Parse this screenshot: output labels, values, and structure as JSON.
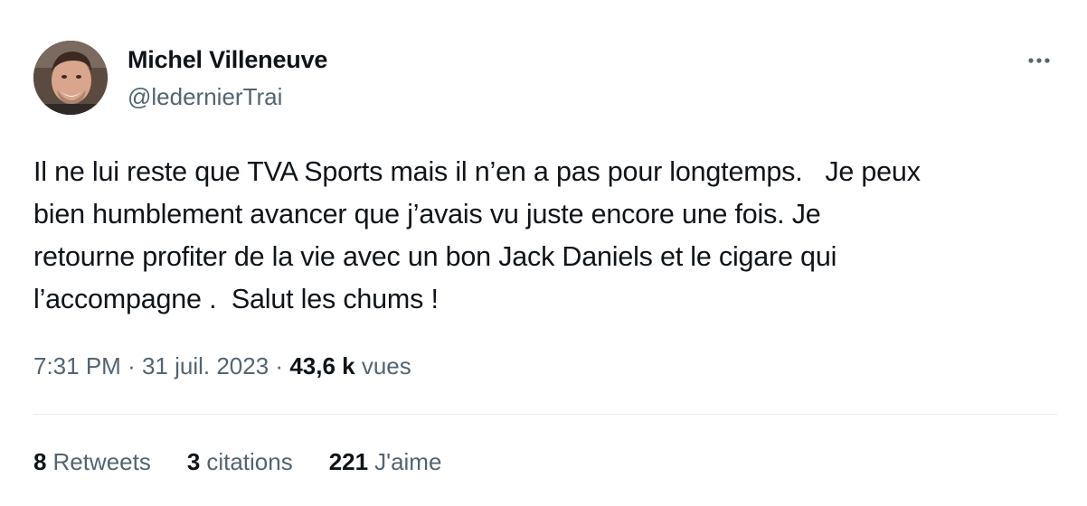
{
  "author": {
    "name": "Michel Villeneuve",
    "handle": "@ledernierTrai"
  },
  "tweet": {
    "lines": [
      "Il ne lui reste que TVA Sports mais il n’en a pas pour longtemps.   Je peux",
      "bien humblement avancer que j’avais vu juste encore une fois. Je",
      "retourne profiter de la vie avec un bon Jack Daniels et le cigare qui",
      "l’accompagne .  Salut les chums !"
    ]
  },
  "meta": {
    "time": "7:31 PM",
    "separator": "·",
    "date": "31 juil. 2023",
    "views_count": "43,6 k",
    "views_label": "vues"
  },
  "stats": {
    "retweets_count": "8",
    "retweets_label": "Retweets",
    "quotes_count": "3",
    "quotes_label": "citations",
    "likes_count": "221",
    "likes_label": "J'aime"
  },
  "icons": {
    "more": "more-horizontal-icon",
    "avatar": "avatar"
  },
  "colors": {
    "text_primary": "#0f1419",
    "text_secondary": "#536471",
    "divider": "#e6ecf0"
  }
}
